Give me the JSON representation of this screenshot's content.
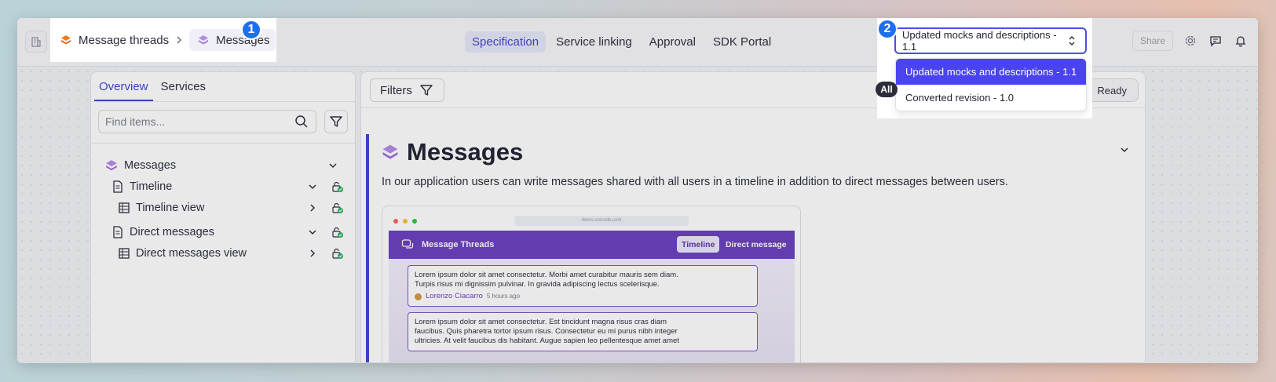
{
  "breadcrumb": {
    "root_label": "Message threads",
    "current_label": "Messages"
  },
  "annotations": {
    "step1": "1",
    "step2": "2"
  },
  "nav": {
    "tabs": [
      {
        "label": "Specification",
        "active": true
      },
      {
        "label": "Service linking",
        "active": false
      },
      {
        "label": "Approval",
        "active": false
      },
      {
        "label": "SDK Portal",
        "active": false
      }
    ]
  },
  "header_actions": {
    "share_label": "Share"
  },
  "revision": {
    "selected": "Updated mocks and descriptions - 1.1",
    "options": [
      {
        "label": "Updated mocks and descriptions - 1.1",
        "selected": true
      },
      {
        "label": "Converted revision - 1.0",
        "selected": false
      }
    ]
  },
  "sidebar": {
    "tabs": [
      {
        "label": "Overview",
        "active": true
      },
      {
        "label": "Services",
        "active": false
      }
    ],
    "search_placeholder": "Find items...",
    "tree": [
      {
        "label": "Messages",
        "icon": "layers-icon",
        "level": 0
      },
      {
        "label": "Timeline",
        "icon": "document-icon",
        "level": 1
      },
      {
        "label": "Timeline view",
        "icon": "table-icon",
        "level": 2
      },
      {
        "label": "Direct messages",
        "icon": "document-icon",
        "level": 1
      },
      {
        "label": "Direct messages view",
        "icon": "table-icon",
        "level": 2
      }
    ]
  },
  "main": {
    "filters_label": "Filters",
    "all_label": "All",
    "ready_label": "Ready",
    "title": "Messages",
    "description": "In our application users can write messages shared with all users in a timeline in addition to direct messages between users."
  },
  "mock": {
    "url": "demo.unicode.com",
    "app_title": "Message Threads",
    "tab_active": "Timeline",
    "tab_other": "Direct message",
    "card1_line1": "Lorem ipsum dolor sit amet consectetur. Morbi amet curabitur mauris sem diam.",
    "card1_line2": "Turpis risus mi dignissim pulvinar. In gravida adipiscing lectus scelerisque.",
    "card1_author": "Lorenzo Ciacarro",
    "card1_time": "5 hours ago",
    "card2_line1": "Lorem ipsum dolor sit amet consectetur. Est tincidunt magna risus cras diam",
    "card2_line2": "faucibus. Quis pharetra tortor ipsum risus. Consectetur eu mi purus nibh integer",
    "card2_line3": "ultricies. At velit faucibus dis habitant. Augue sapien leo pellentesque amet amet"
  },
  "colors": {
    "accent": "#3f47c9",
    "badge": "#1e6ff0",
    "selected_option": "#4a43f0",
    "mock_header": "#6a3fbf"
  }
}
